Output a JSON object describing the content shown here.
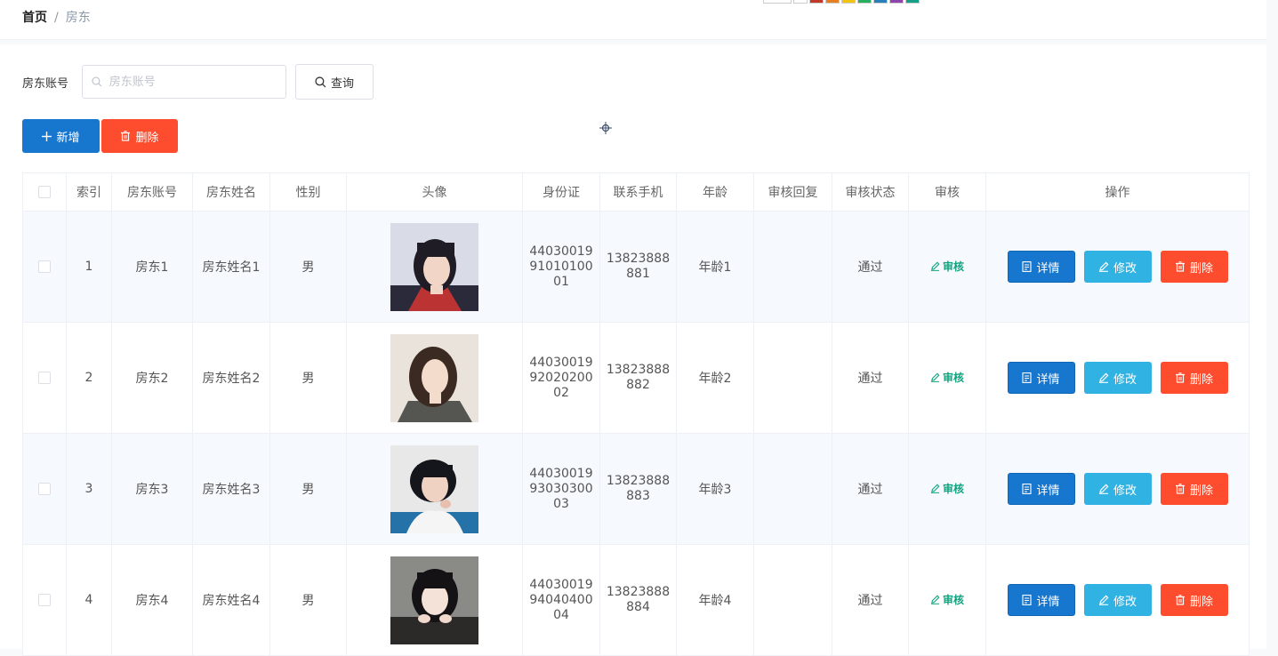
{
  "breadcrumb": {
    "home": "首页",
    "separator": "/",
    "current": "房东"
  },
  "search": {
    "label": "房东账号",
    "placeholder": "房东账号",
    "value": "",
    "query_label": "查询"
  },
  "actions": {
    "add_label": "新增",
    "delete_label": "删除"
  },
  "colors": {
    "primary": "#1777cf",
    "info": "#30b3e3",
    "danger": "#fe4c2e",
    "audit": "#10a37f"
  },
  "table": {
    "headers": [
      "索引",
      "房东账号",
      "房东姓名",
      "性别",
      "头像",
      "身份证",
      "联系手机",
      "年龄",
      "审核回复",
      "审核状态",
      "审核",
      "操作"
    ],
    "rows": [
      {
        "index": "1",
        "account": "房东1",
        "name": "房东姓名1",
        "gender": "男",
        "id_lines": [
          "44030019",
          "91010100",
          "01"
        ],
        "phone_lines": [
          "13823888",
          "881"
        ],
        "age": "年龄1",
        "reply": "",
        "status": "通过",
        "audit": "审核",
        "detail": "详情",
        "edit": "修改",
        "delete": "删除"
      },
      {
        "index": "2",
        "account": "房东2",
        "name": "房东姓名2",
        "gender": "男",
        "id_lines": [
          "44030019",
          "92020200",
          "02"
        ],
        "phone_lines": [
          "13823888",
          "882"
        ],
        "age": "年龄2",
        "reply": "",
        "status": "通过",
        "audit": "审核",
        "detail": "详情",
        "edit": "修改",
        "delete": "删除"
      },
      {
        "index": "3",
        "account": "房东3",
        "name": "房东姓名3",
        "gender": "男",
        "id_lines": [
          "44030019",
          "93030300",
          "03"
        ],
        "phone_lines": [
          "13823888",
          "883"
        ],
        "age": "年龄3",
        "reply": "",
        "status": "通过",
        "audit": "审核",
        "detail": "详情",
        "edit": "修改",
        "delete": "删除"
      },
      {
        "index": "4",
        "account": "房东4",
        "name": "房东姓名4",
        "gender": "男",
        "id_lines": [
          "44030019",
          "94040400",
          "04"
        ],
        "phone_lines": [
          "13823888",
          "884"
        ],
        "age": "年龄4",
        "reply": "",
        "status": "通过",
        "audit": "审核",
        "detail": "详情",
        "edit": "修改",
        "delete": "删除"
      }
    ]
  }
}
